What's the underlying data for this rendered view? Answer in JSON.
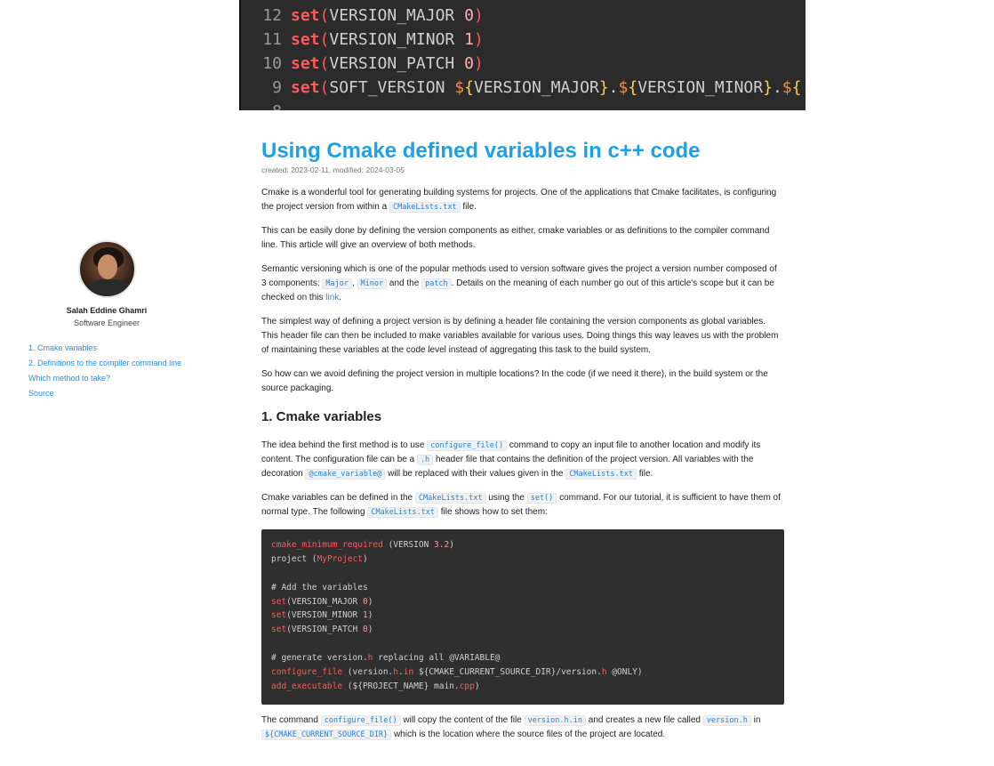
{
  "hero": {
    "lines": [
      {
        "num": "12",
        "kw": "set",
        "name": "VERSION_MAJOR",
        "val": "0"
      },
      {
        "num": "11",
        "kw": "set",
        "name": "VERSION_MINOR",
        "val": "1"
      },
      {
        "num": "10",
        "kw": "set",
        "name": "VERSION_PATCH",
        "val": "0"
      },
      {
        "num": "9",
        "kw": "set",
        "name": "SOFT_VERSION",
        "v1": "VERSION_MAJOR",
        "v2": "VERSION_MINOR"
      }
    ],
    "partial_num": "8"
  },
  "author": {
    "name": "Salah Eddine Ghamri",
    "role": "Software Engineer"
  },
  "toc": [
    "1. Cmake variables",
    "2. Definitions to the compiler command line",
    "Which method to take?",
    "Source"
  ],
  "article": {
    "title": "Using Cmake defined variables in c++ code",
    "meta": "created: 2023-02-11, modified: 2024-03-05",
    "p1": {
      "t1": "Cmake is a wonderful tool for generating building systems for projects. One of the applications that Cmake facilitates, is configuring the project version from within a",
      "c1": "CMakeLists.txt",
      "t2": "file."
    },
    "p2": "This can be easily done by defining the version components as either, cmake variables or as definitions to the compiler command line. This article will give an overview of both methods.",
    "p3": {
      "t1": "Semantic versioning which is one of the popular methods used to version software gives the project a version number composed of 3 components:",
      "c1": "Major",
      "sep": ",",
      "c2": "Minor",
      "t2": "and the",
      "c3": "patch",
      "t3": ". Details on the meaning of each number go out of this article's scope but it can be checked on this",
      "link": "link",
      "t4": "."
    },
    "p4": "The simplest way of defining a project version is by defining a header file containing the version components as global variables. This header file can then be included to make variables available for various uses. Doing things this way leaves us with the problem of maintaining these variables at the code level instead of aggregating this task to the build system.",
    "p5": "So how can we avoid defining the project version in multiple locations? In the code (if we need it there), in the build system or the source packaging.",
    "h2": "1. Cmake variables",
    "p6": {
      "t1": "The idea behind the first method is to use",
      "c1": "configure_file()",
      "t2": "command to copy an input file to another location and modify its content. The configuration file can be a",
      "c2": ".h",
      "t3": "header file that contains the definition of the project version. All variables with the decoration",
      "c3": "@cmake_variable@",
      "t4": "will be replaced with their values given in the",
      "c4": "CMakeLists.txt",
      "t5": "file."
    },
    "p7": {
      "t1": "Cmake variables can be defined in the",
      "c1": "CMakeLists.txt",
      "t2": "using the",
      "c2": "set()",
      "t3": "command. For our tutorial, it is sufficient to have them of normal type. The following",
      "c3": "CMakeLists.txt",
      "t4": "file shows how to set them:"
    },
    "p8": {
      "t1": "The command",
      "c1": "configure_file()",
      "t2": "will copy the content of the file",
      "c2": "version.h.in",
      "t3": "and creates a new file called",
      "c3": "version.h",
      "t4": "in",
      "c4": "${CMAKE_CURRENT_SOURCE_DIR}",
      "t5": "which is the location where the source files of the project are located."
    }
  },
  "code": {
    "l1": {
      "k": "cmake_minimum_required",
      "t": " (VERSION ",
      "n": "3.2",
      "e": ")"
    },
    "l2": {
      "k": "project",
      "t": " (",
      "s": "MyProject",
      "e": ")"
    },
    "l3": "# Add the variables",
    "l4": {
      "k": "set",
      "t": "(VERSION_MAJOR ",
      "n": "0",
      "e": ")"
    },
    "l5": {
      "k": "set",
      "t": "(VERSION_MINOR ",
      "n": "1",
      "e": ")"
    },
    "l6": {
      "k": "set",
      "t": "(VERSION_PATCH ",
      "n": "0",
      "e": ")"
    },
    "l7": {
      "t": "# generate version.",
      "k": "h",
      "e": " replacing all @VARIABLE@"
    },
    "l8": {
      "k": "configure_file",
      "t": " (version.",
      "k2": "h",
      "t2": ".",
      "k3": "in",
      "t3": " ${CMAKE_CURRENT_SOURCE_DIR}/version.",
      "k4": "h",
      "e": " @ONLY)"
    },
    "l9": {
      "k": "add_executable",
      "t": " (${PROJECT_NAME} main.",
      "s": "cpp",
      "e": ")"
    }
  }
}
